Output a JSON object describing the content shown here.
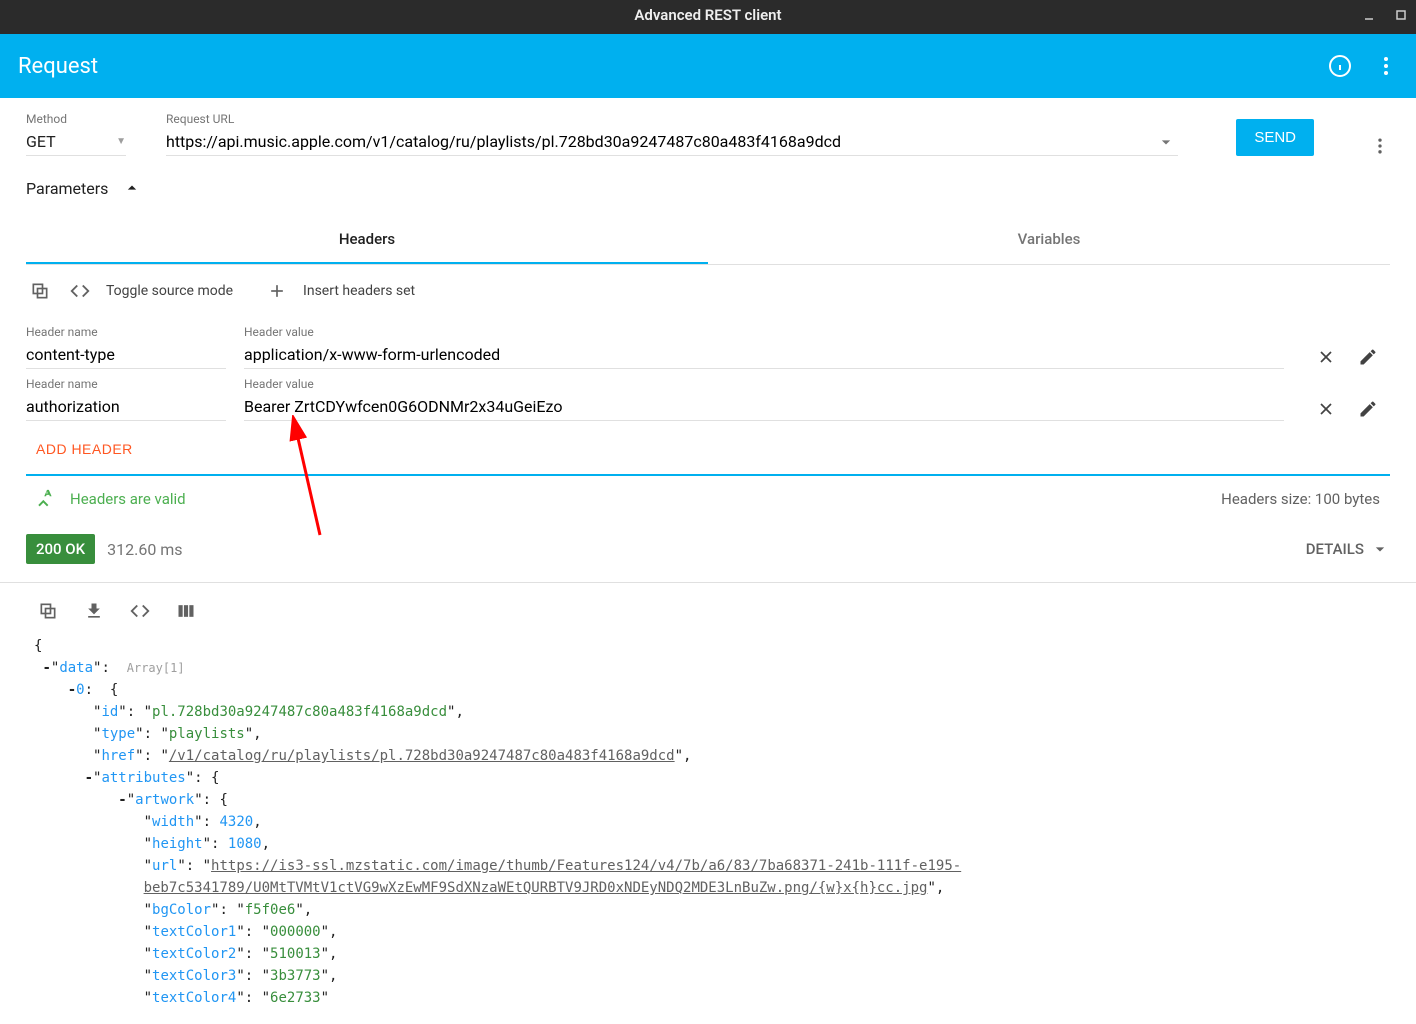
{
  "window": {
    "title": "Advanced REST client"
  },
  "appbar": {
    "title": "Request"
  },
  "request": {
    "method_label": "Method",
    "method_value": "GET",
    "url_label": "Request URL",
    "url_value": "https://api.music.apple.com/v1/catalog/ru/playlists/pl.728bd30a9247487c80a483f4168a9dcd",
    "send_label": "SEND"
  },
  "params": {
    "label": "Parameters"
  },
  "tabs": {
    "headers": "Headers",
    "variables": "Variables"
  },
  "headers_toolbar": {
    "toggle_label": "Toggle source mode",
    "insert_label": "Insert headers set"
  },
  "header_field_labels": {
    "name": "Header name",
    "value": "Header value"
  },
  "headers": [
    {
      "name": "content-type",
      "value": "application/x-www-form-urlencoded"
    },
    {
      "name": "authorization",
      "value": "Bearer ZrtCDYwfcen0G6ODNMr2x34uGeiEzo"
    }
  ],
  "add_header_label": "ADD HEADER",
  "validation": {
    "valid_text": "Headers are valid",
    "size_text": "Headers size: 100 bytes"
  },
  "status": {
    "badge": "200 OK",
    "timing": "312.60 ms",
    "details_label": "DETAILS"
  },
  "response": {
    "raw": {
      "data_key": "data",
      "array_hint": "Array[1]",
      "idx": "0",
      "id_key": "id",
      "id_val": "pl.728bd30a9247487c80a483f4168a9dcd",
      "type_key": "type",
      "type_val": "playlists",
      "href_key": "href",
      "href_val": "/v1/catalog/ru/playlists/pl.728bd30a9247487c80a483f4168a9dcd",
      "attributes_key": "attributes",
      "artwork_key": "artwork",
      "width_key": "width",
      "width_val": "4320",
      "height_key": "height",
      "height_val": "1080",
      "url_key": "url",
      "url_val_1": "https://is3-ssl.mzstatic.com/image/thumb/Features124/v4/7b/a6/83/7ba68371-241b-111f-e195-",
      "url_val_2": "beb7c5341789/U0MtTVMtV1ctVG9wXzEwMF9SdXNzaWEtQURBTV9JRD0xNDEyNDQ2MDE3LnBuZw.png/{w}x{h}cc.jpg",
      "bgColor_key": "bgColor",
      "bgColor_val": "f5f0e6",
      "tc1_key": "textColor1",
      "tc1_val": "000000",
      "tc2_key": "textColor2",
      "tc2_val": "510013",
      "tc3_key": "textColor3",
      "tc3_val": "3b3773",
      "tc4_key": "textColor4",
      "tc4_val": "6e2733"
    }
  }
}
